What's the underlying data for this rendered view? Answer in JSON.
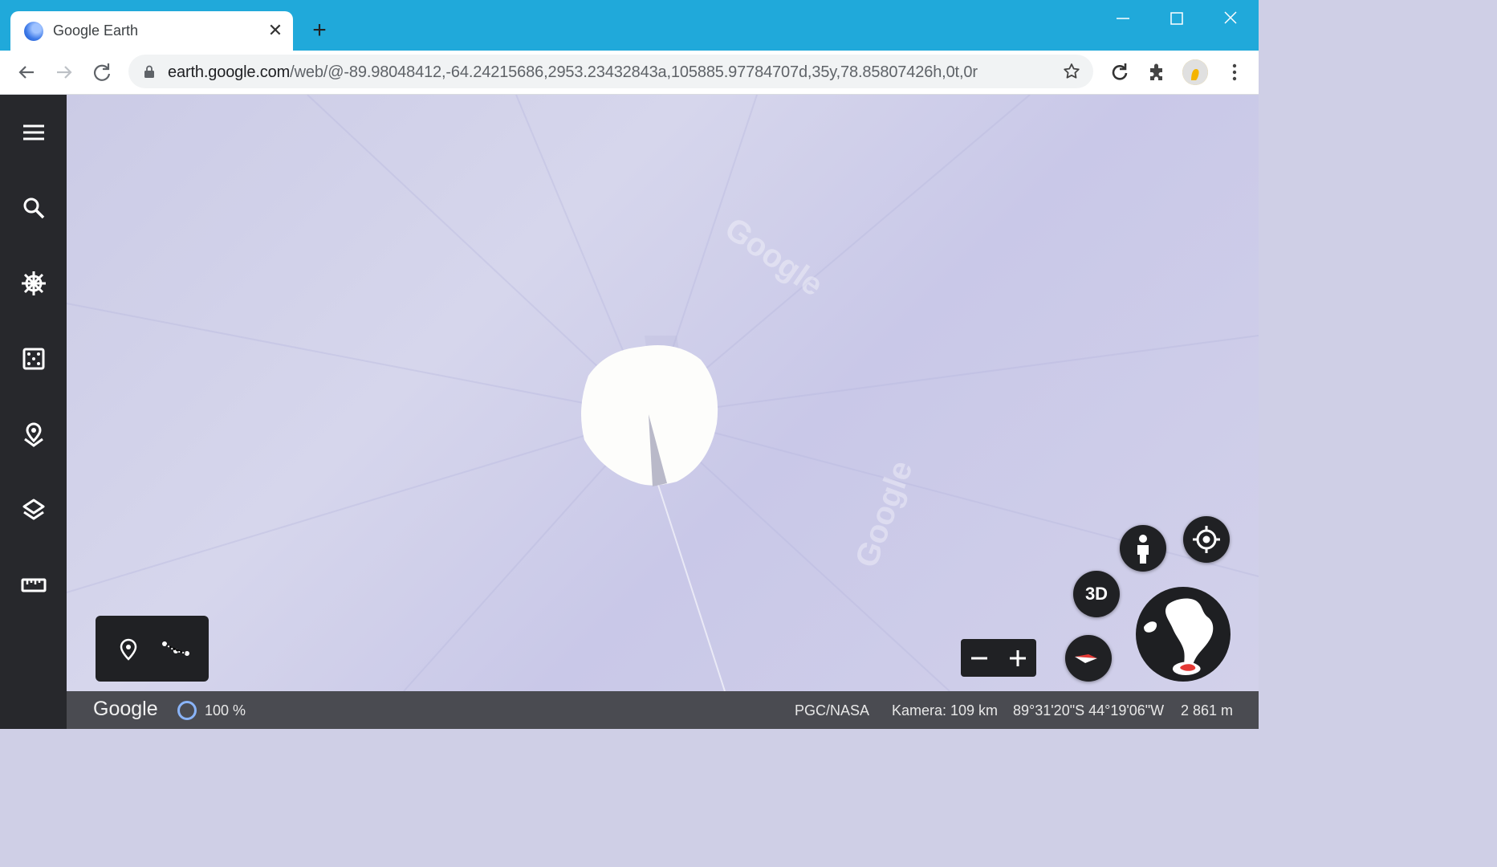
{
  "browser": {
    "tab_title": "Google Earth",
    "url_host": "earth.google.com",
    "url_path": "/web/@-89.98048412,-64.24215686,2953.23432843a,105885.97784707d,35y,78.85807426h,0t,0r"
  },
  "map": {
    "watermark": "Google",
    "btn_3d": "3D"
  },
  "status": {
    "logo": "Google",
    "load_percent": "100 %",
    "attribution": "PGC/NASA",
    "camera": "Kamera: 109 km",
    "coordinates": "89°31'20\"S 44°19'06\"W",
    "elevation": "2 861 m"
  },
  "colors": {
    "tabbar": "#20a9da",
    "sidebar": "#27282c",
    "statusbar": "#4a4b51",
    "map_bg": "#cfcfe6"
  }
}
